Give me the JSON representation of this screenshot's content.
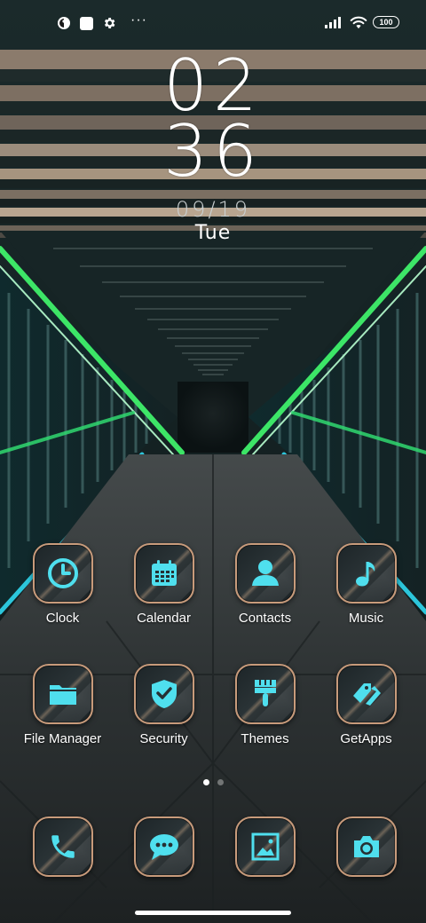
{
  "status_bar": {
    "battery_level": "100",
    "left_icons": [
      "notification-app-icon",
      "white-square-icon",
      "gear-icon"
    ],
    "more_indicator": "···",
    "right_icons": [
      "signal-icon",
      "wifi-icon",
      "battery-icon"
    ]
  },
  "clock": {
    "hours": "02",
    "minutes": "36",
    "date": "09/19",
    "weekday": "Tue"
  },
  "apps": [
    {
      "label": "Clock",
      "icon": "clock-icon"
    },
    {
      "label": "Calendar",
      "icon": "calendar-icon"
    },
    {
      "label": "Contacts",
      "icon": "contact-person-icon"
    },
    {
      "label": "Music",
      "icon": "music-note-icon"
    },
    {
      "label": "File Manager",
      "icon": "folder-icon"
    },
    {
      "label": "Security",
      "icon": "shield-check-icon"
    },
    {
      "label": "Themes",
      "icon": "paint-brush-icon"
    },
    {
      "label": "GetApps",
      "icon": "tag-arrow-icon"
    }
  ],
  "dock": [
    {
      "icon": "phone-icon"
    },
    {
      "icon": "message-bubble-icon"
    },
    {
      "icon": "gallery-icon"
    },
    {
      "icon": "camera-icon"
    }
  ],
  "page_indicator": {
    "pages": 2,
    "active": 1
  },
  "colors": {
    "icon_glyph": "#4fdfee",
    "icon_border": "#c89b7b",
    "wallpaper_neon_green": "#3ff06a",
    "wallpaper_neon_cyan": "#30d8f0"
  }
}
